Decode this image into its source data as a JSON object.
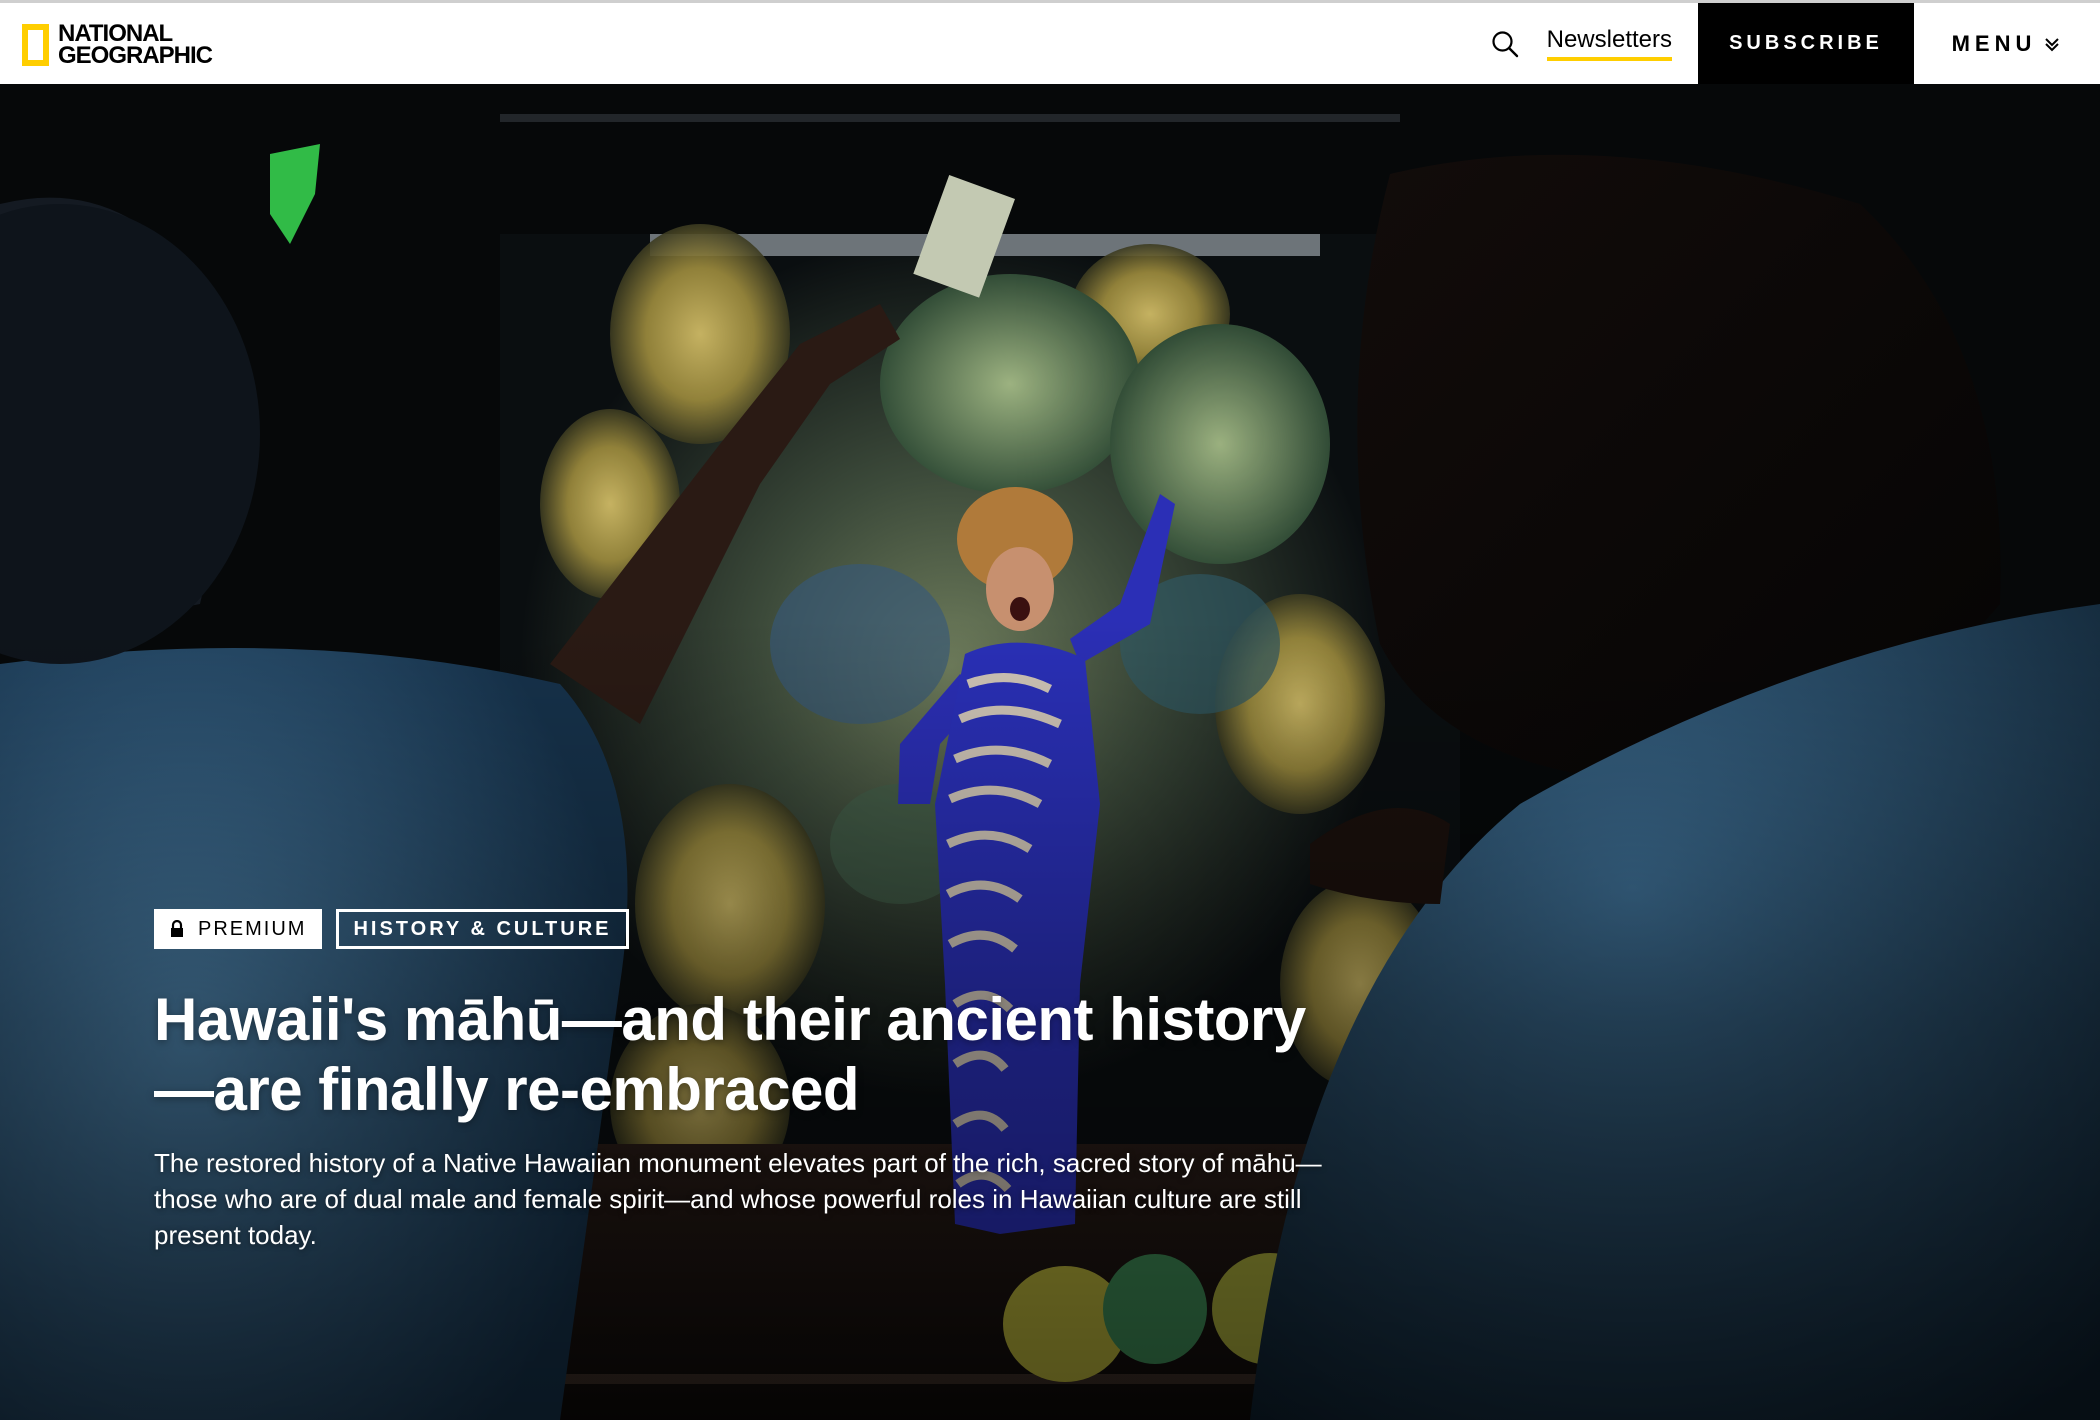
{
  "header": {
    "logo_line1": "NATIONAL",
    "logo_line2": "GEOGRAPHIC",
    "search_icon": "search-icon",
    "newsletters_label": "Newsletters",
    "subscribe_label": "SUBSCRIBE",
    "menu_label": "MENU",
    "menu_icon": "chevron-down-icon",
    "brand_color": "#ffce00"
  },
  "hero": {
    "tags": {
      "premium_label": "PREMIUM",
      "premium_icon": "lock-icon",
      "category_label": "HISTORY & CULTURE"
    },
    "headline_line1": "Hawaii's māhū—and their ancient history",
    "headline_line2": "—are finally re-embraced",
    "dek": "The restored history of a Native Hawaiian monument elevates part of the rich, sacred story of māhū—those who are of dual male and female spirit—and whose powerful roles in Hawaiian culture are still present today."
  }
}
